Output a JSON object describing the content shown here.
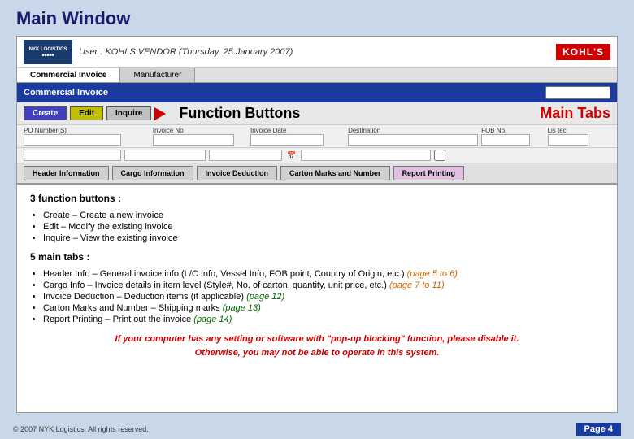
{
  "page": {
    "title": "Main Window"
  },
  "user_bar": {
    "user_info": "User : KOHLS VENDOR  (Thursday, 25 January 2007)",
    "kohls_logo": "KOHL'S"
  },
  "nav_tabs": {
    "tab1": "Commercial Invoice",
    "tab2": "Manufacturer"
  },
  "blue_header": {
    "title": "Commercial Invoice"
  },
  "function_buttons": {
    "create": "Create",
    "edit": "Edit",
    "inquire": "Inquire",
    "function_label": "Function Buttons",
    "main_tabs_label": "Main Tabs"
  },
  "form_fields": {
    "po_number_label": "PO Number(S)",
    "invoice_no_label": "Invoice No",
    "invoice_date_label": "Invoice Date",
    "destination_label": "Destination",
    "fob_no_label": "FOB No.",
    "listed_label": "Lis tec"
  },
  "tab_buttons": {
    "header_info": "Header Information",
    "cargo_info": "Cargo Information",
    "invoice_deduction": "Invoice Deduction",
    "carton_marks": "Carton Marks and Number",
    "report_printing": "Report Printing"
  },
  "content": {
    "function_section_title": "3 function buttons :",
    "function_items": [
      "Create – Create a new invoice",
      "Edit – Modify the existing invoice",
      "Inquire – View the existing invoice"
    ],
    "tabs_section_title": "5 main tabs :",
    "tabs_items": [
      {
        "prefix": "Header Info – General invoice info (L/C Info, Vessel Info, FOB point, Country of Origin, etc.)",
        "suffix": "(page 5 to 6)"
      },
      {
        "prefix": "Cargo Info – Invoice details in item level (Style#, No. of carton, quantity, unit price, etc.)",
        "suffix": "(page 7 to 11)"
      },
      {
        "prefix": "Invoice Deduction – Deduction items (if applicable)",
        "suffix": "(page 12)"
      },
      {
        "prefix": "Carton Marks and Number – Shipping marks",
        "suffix": "(page 13)"
      },
      {
        "prefix": "Report Printing – Print out the invoice",
        "suffix": "(page 14)"
      }
    ],
    "warning_line1": "If your computer has any setting or software with \"pop-up blocking\" function, please disable it.",
    "warning_line2": "Otherwise, you may not be able to operate in this system."
  },
  "footer": {
    "copyright": "© 2007 NYK Logistics. All rights reserved.",
    "page": "Page 4"
  }
}
